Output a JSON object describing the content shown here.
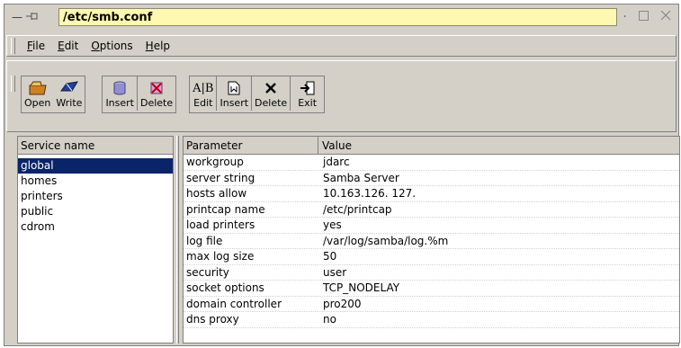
{
  "window": {
    "title": "/etc/smb.conf",
    "left_icons": [
      "minimize-dash-icon",
      "pin-icon"
    ],
    "right_icons": [
      "dot-icon",
      "maximize-icon",
      "close-icon"
    ]
  },
  "menu": {
    "items": [
      {
        "label": "File",
        "mnemonic": "F"
      },
      {
        "label": "Edit",
        "mnemonic": "E"
      },
      {
        "label": "Options",
        "mnemonic": "O"
      },
      {
        "label": "Help",
        "mnemonic": "H"
      }
    ]
  },
  "toolbar": {
    "open_label": "Open",
    "write_label": "Write",
    "service_insert_label": "Insert",
    "service_delete_label": "Delete",
    "param_edit_label": "Edit",
    "param_insert_label": "Insert",
    "param_delete_label": "Delete",
    "exit_label": "Exit"
  },
  "services": {
    "header": "Service name",
    "items": [
      "global",
      "homes",
      "printers",
      "public",
      "cdrom"
    ],
    "selected": "global"
  },
  "parameters": {
    "header_param": "Parameter",
    "header_value": "Value",
    "rows": [
      {
        "param": "workgroup",
        "value": "jdarc"
      },
      {
        "param": "server string",
        "value": "Samba Server"
      },
      {
        "param": "hosts allow",
        "value": "10.163.126. 127."
      },
      {
        "param": "printcap name",
        "value": "/etc/printcap"
      },
      {
        "param": "load printers",
        "value": "yes"
      },
      {
        "param": "log file",
        "value": "/var/log/samba/log.%m"
      },
      {
        "param": "max log size",
        "value": "50"
      },
      {
        "param": "security",
        "value": "user"
      },
      {
        "param": "socket options",
        "value": "TCP_NODELAY"
      },
      {
        "param": "domain controller",
        "value": "pro200"
      },
      {
        "param": "dns proxy",
        "value": "no"
      }
    ]
  },
  "colors": {
    "title_bg": "#fff8b0",
    "selection_bg": "#0a246a",
    "chrome_bg": "#d4d0c8"
  }
}
